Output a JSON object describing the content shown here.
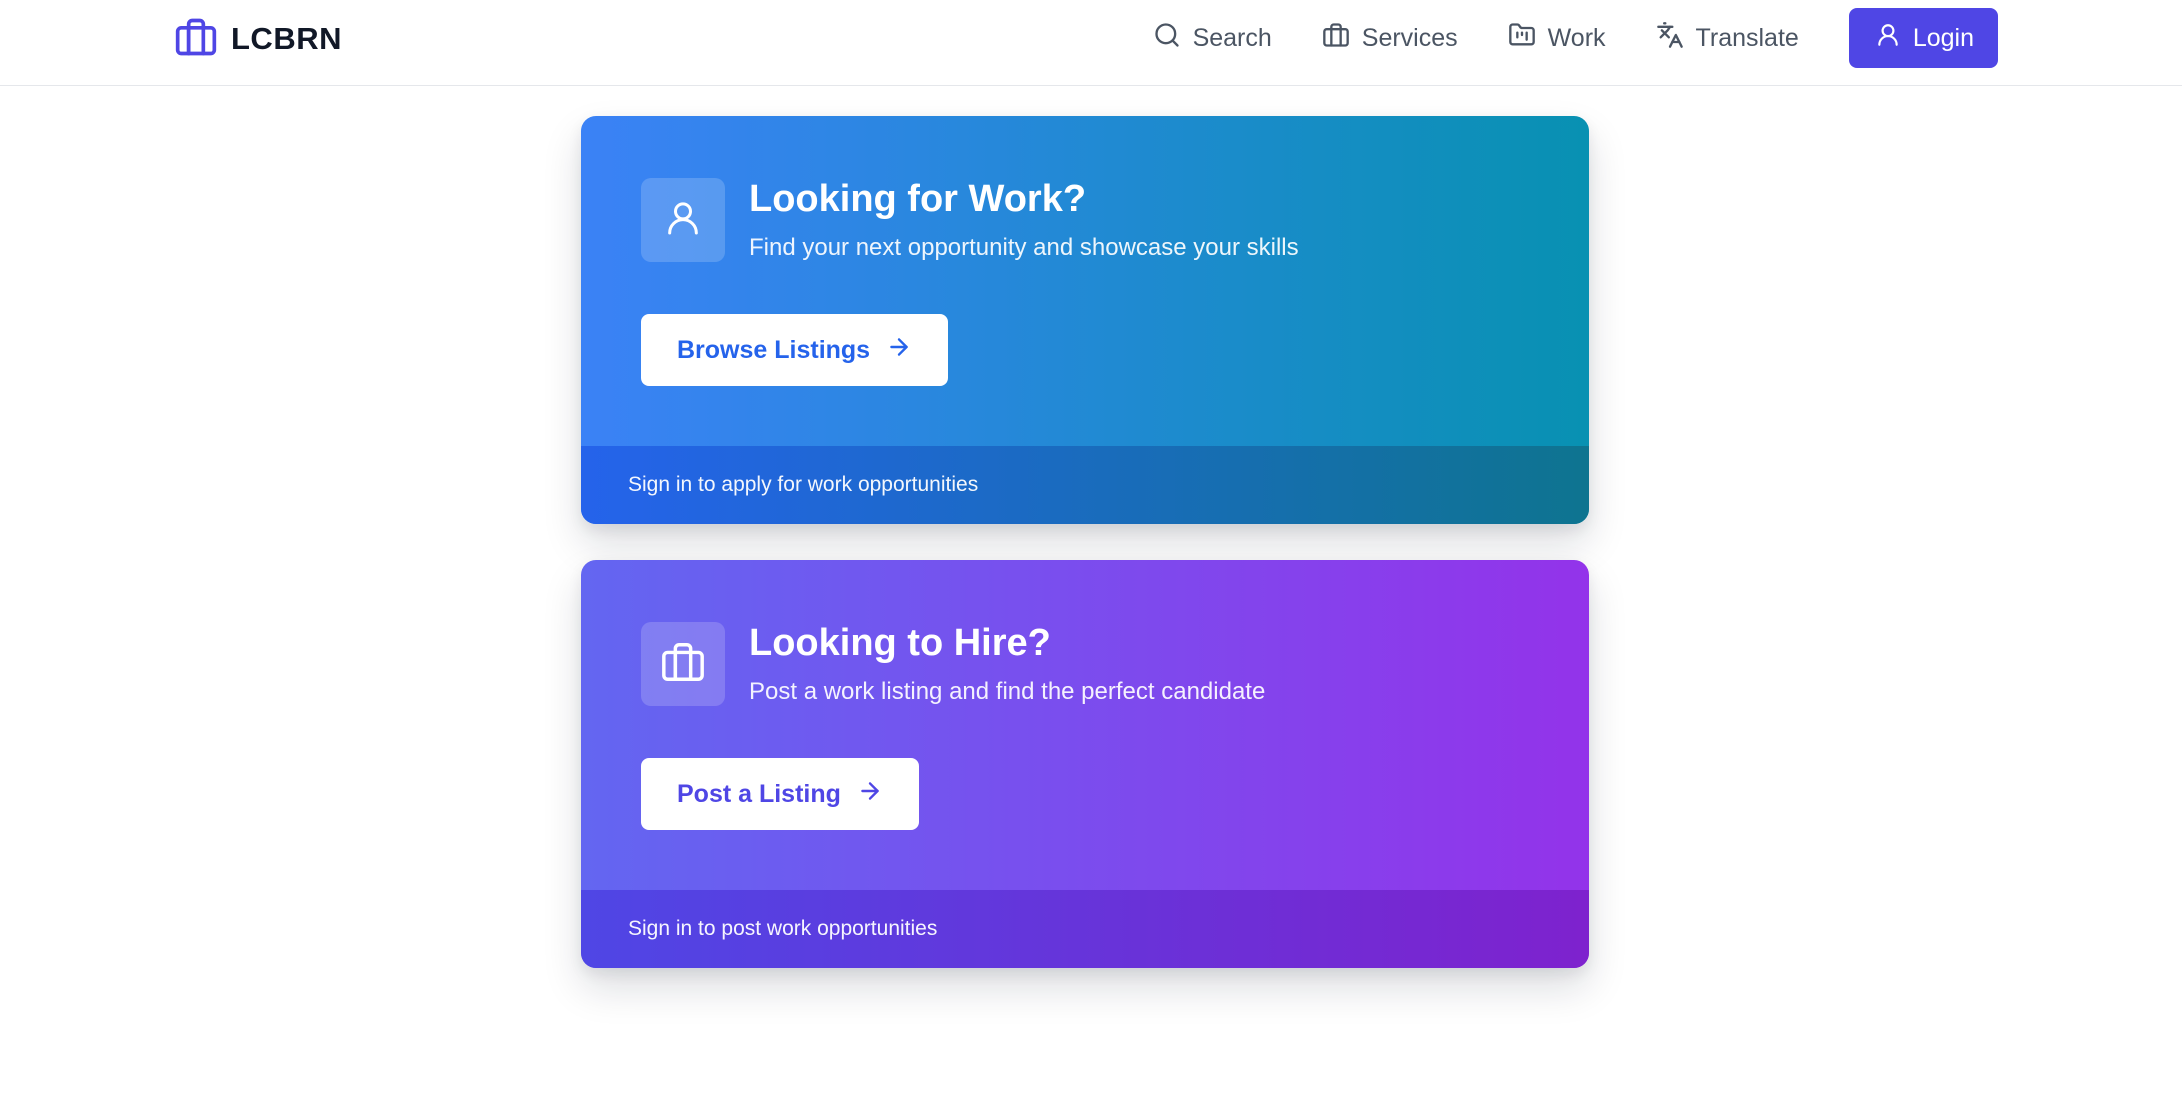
{
  "brand": {
    "name": "LCBRN",
    "color": "#4f46e5"
  },
  "nav": {
    "items": [
      {
        "label": "Search",
        "icon": "search-icon"
      },
      {
        "label": "Services",
        "icon": "briefcase-icon"
      },
      {
        "label": "Work",
        "icon": "folder-kanban-icon"
      },
      {
        "label": "Translate",
        "icon": "languages-icon"
      }
    ],
    "login": {
      "label": "Login",
      "icon": "user-icon",
      "color": "#4f46e5"
    }
  },
  "cards": [
    {
      "title": "Looking for Work?",
      "subtitle": "Find your next opportunity and showcase your skills",
      "button": "Browse Listings",
      "footer": "Sign in to apply for work opportunities",
      "icon": "user-icon",
      "colors": [
        "#3b82f6",
        "#0891b2"
      ]
    },
    {
      "title": "Looking to Hire?",
      "subtitle": "Post a work listing and find the perfect candidate",
      "button": "Post a Listing",
      "footer": "Sign in to post work opportunities",
      "icon": "briefcase-icon",
      "colors": [
        "#6366f1",
        "#9333ea"
      ]
    }
  ]
}
